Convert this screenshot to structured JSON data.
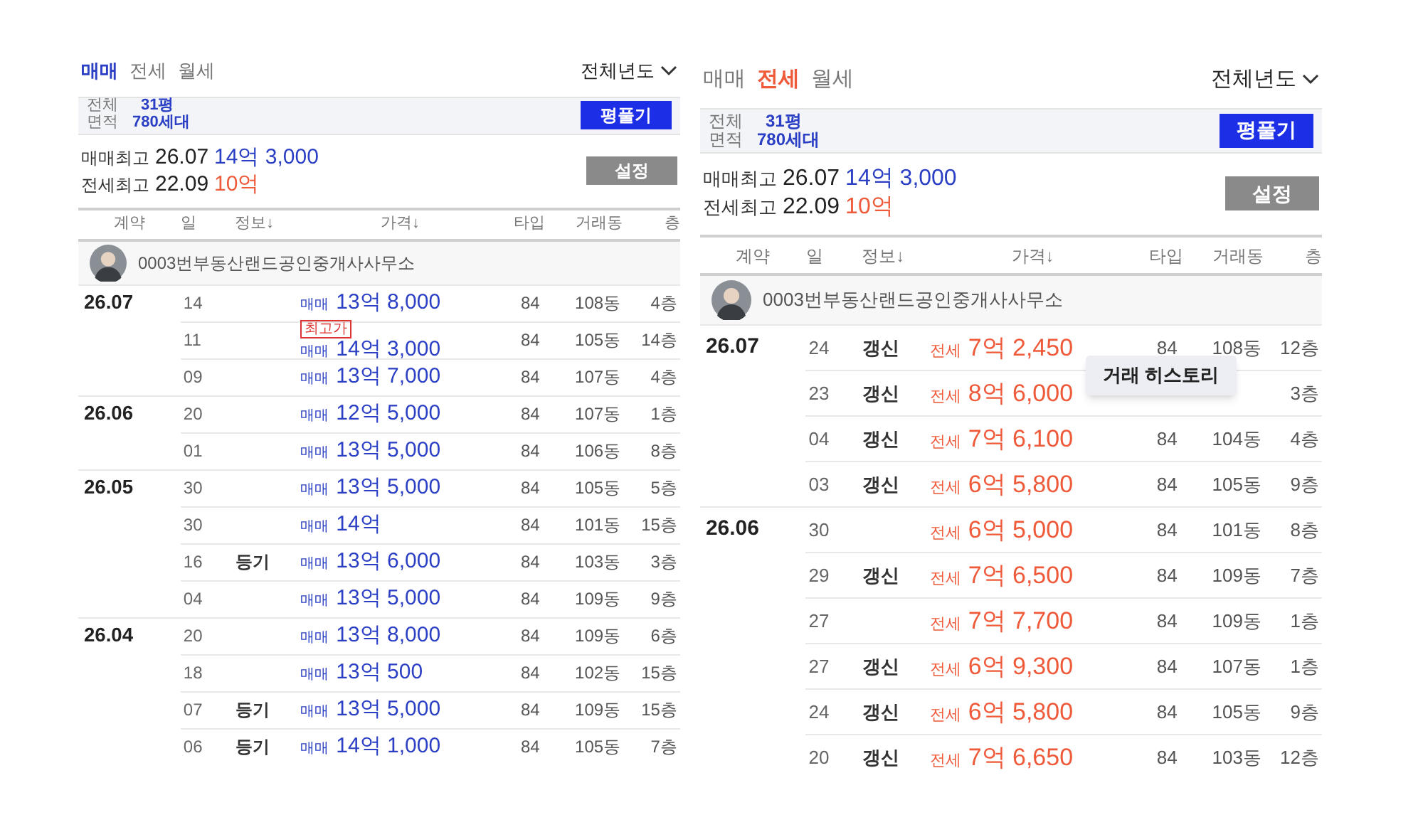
{
  "panels": [
    {
      "tabs": [
        {
          "label": "매매",
          "selected": true
        },
        {
          "label": "전세",
          "selected": false
        },
        {
          "label": "월세",
          "selected": false
        }
      ],
      "period": "전체년도",
      "area": {
        "label_top": "전체",
        "label_bottom": "면적",
        "size": "31평",
        "households": "780세대"
      },
      "area_button": "평풀기",
      "highs": [
        {
          "label": "매매최고",
          "date": "26.07",
          "price": "14억 3,000",
          "kind": "sale"
        },
        {
          "label": "전세최고",
          "date": "22.09",
          "price": "10억",
          "kind": "jeonse"
        }
      ],
      "settings_button": "설정",
      "columns": [
        "계약",
        "일",
        "정보↓",
        "가격↓",
        "타입",
        "거래동",
        "층"
      ],
      "agent": "0003번부동산랜드공인중개사사무소",
      "rows": [
        {
          "month": "26.07",
          "day": "14",
          "deal": "매매",
          "kind": "sale",
          "price": "13억 8,000",
          "type": "84",
          "dong": "108동",
          "floor": "4층"
        },
        {
          "day": "11",
          "badge": "최고가",
          "deal": "매매",
          "kind": "sale",
          "price": "14억 3,000",
          "type": "84",
          "dong": "105동",
          "floor": "14층"
        },
        {
          "day": "09",
          "deal": "매매",
          "kind": "sale",
          "price": "13억 7,000",
          "type": "84",
          "dong": "107동",
          "floor": "4층"
        },
        {
          "month": "26.06",
          "day": "20",
          "deal": "매매",
          "kind": "sale",
          "price": "12억 5,000",
          "type": "84",
          "dong": "107동",
          "floor": "1층"
        },
        {
          "day": "01",
          "deal": "매매",
          "kind": "sale",
          "price": "13억 5,000",
          "type": "84",
          "dong": "106동",
          "floor": "8층"
        },
        {
          "month": "26.05",
          "day": "30",
          "deal": "매매",
          "kind": "sale",
          "price": "13억 5,000",
          "type": "84",
          "dong": "105동",
          "floor": "5층"
        },
        {
          "day": "30",
          "deal": "매매",
          "kind": "sale",
          "price": "14억",
          "type": "84",
          "dong": "101동",
          "floor": "15층"
        },
        {
          "day": "16",
          "info": "등기",
          "deal": "매매",
          "kind": "sale",
          "price": "13억 6,000",
          "type": "84",
          "dong": "103동",
          "floor": "3층"
        },
        {
          "day": "04",
          "deal": "매매",
          "kind": "sale",
          "price": "13억 5,000",
          "type": "84",
          "dong": "109동",
          "floor": "9층"
        },
        {
          "month": "26.04",
          "day": "20",
          "deal": "매매",
          "kind": "sale",
          "price": "13억 8,000",
          "type": "84",
          "dong": "109동",
          "floor": "6층"
        },
        {
          "day": "18",
          "deal": "매매",
          "kind": "sale",
          "price": "13억 500",
          "type": "84",
          "dong": "102동",
          "floor": "15층"
        },
        {
          "day": "07",
          "info": "등기",
          "deal": "매매",
          "kind": "sale",
          "price": "13억 5,000",
          "type": "84",
          "dong": "109동",
          "floor": "15층"
        },
        {
          "day": "06",
          "info": "등기",
          "deal": "매매",
          "kind": "sale",
          "price": "14억 1,000",
          "type": "84",
          "dong": "105동",
          "floor": "7층"
        }
      ]
    },
    {
      "tabs": [
        {
          "label": "매매",
          "selected": false
        },
        {
          "label": "전세",
          "selected": true
        },
        {
          "label": "월세",
          "selected": false
        }
      ],
      "period": "전체년도",
      "area": {
        "label_top": "전체",
        "label_bottom": "면적",
        "size": "31평",
        "households": "780세대"
      },
      "area_button": "평풀기",
      "highs": [
        {
          "label": "매매최고",
          "date": "26.07",
          "price": "14억 3,000",
          "kind": "sale"
        },
        {
          "label": "전세최고",
          "date": "22.09",
          "price": "10억",
          "kind": "jeonse"
        }
      ],
      "settings_button": "설정",
      "columns": [
        "계약",
        "일",
        "정보↓",
        "가격↓",
        "타입",
        "거래동",
        "층"
      ],
      "agent": "0003번부동산랜드공인중개사사무소",
      "rows": [
        {
          "month": "26.07",
          "day": "24",
          "info": "갱신",
          "deal": "전세",
          "kind": "jeonse",
          "price": "7억 2,450",
          "type": "84",
          "dong": "108동",
          "floor": "12층",
          "tooltip": "거래 히스토리"
        },
        {
          "day": "23",
          "info": "갱신",
          "deal": "전세",
          "kind": "jeonse",
          "price": "8억 6,000",
          "floor": "3층"
        },
        {
          "day": "04",
          "info": "갱신",
          "deal": "전세",
          "kind": "jeonse",
          "price": "7억 6,100",
          "type": "84",
          "dong": "104동",
          "floor": "4층"
        },
        {
          "day": "03",
          "info": "갱신",
          "deal": "전세",
          "kind": "jeonse",
          "price": "6억 5,800",
          "type": "84",
          "dong": "105동",
          "floor": "9층"
        },
        {
          "month": "26.06",
          "day": "30",
          "deal": "전세",
          "kind": "jeonse",
          "price": "6억 5,000",
          "type": "84",
          "dong": "101동",
          "floor": "8층"
        },
        {
          "day": "29",
          "info": "갱신",
          "deal": "전세",
          "kind": "jeonse",
          "price": "7억 6,500",
          "type": "84",
          "dong": "109동",
          "floor": "7층"
        },
        {
          "day": "27",
          "deal": "전세",
          "kind": "jeonse",
          "price": "7억 7,700",
          "type": "84",
          "dong": "109동",
          "floor": "1층"
        },
        {
          "day": "27",
          "info": "갱신",
          "deal": "전세",
          "kind": "jeonse",
          "price": "6억 9,300",
          "type": "84",
          "dong": "107동",
          "floor": "1층"
        },
        {
          "day": "24",
          "info": "갱신",
          "deal": "전세",
          "kind": "jeonse",
          "price": "6억 5,800",
          "type": "84",
          "dong": "105동",
          "floor": "9층"
        },
        {
          "day": "20",
          "info": "갱신",
          "deal": "전세",
          "kind": "jeonse",
          "price": "7억 6,650",
          "type": "84",
          "dong": "103동",
          "floor": "12층"
        }
      ]
    }
  ]
}
